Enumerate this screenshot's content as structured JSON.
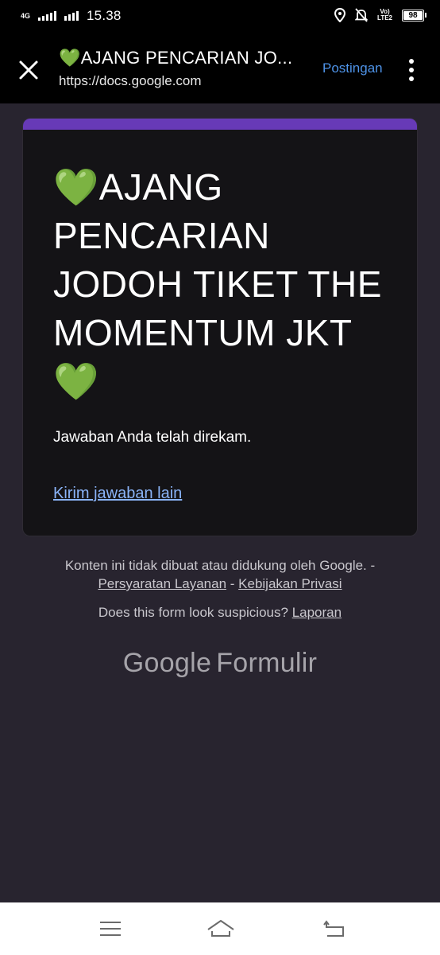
{
  "status_bar": {
    "network_type": "4G",
    "time": "15.38",
    "volte_label": "VoLTE2",
    "battery_level": "98",
    "icons": [
      "signal-icon",
      "location-icon",
      "mute-icon",
      "battery-icon"
    ]
  },
  "app_bar": {
    "title": "💚AJANG PENCARIAN JO...",
    "url": "https://docs.google.com",
    "action_label": "Postingan",
    "icons": [
      "close-icon",
      "more-vert-icon"
    ]
  },
  "form": {
    "accent_color": "#673ab7",
    "title": "💚AJANG PENCARIAN JODOH TIKET THE MOMENTUM JKT 💚",
    "confirmation_message": "Jawaban Anda telah direkam.",
    "resubmit_link": "Kirim jawaban lain"
  },
  "footer": {
    "disclaimer": "Konten ini tidak dibuat atau didukung oleh Google. -",
    "terms_link": "Persyaratan Layanan",
    "separator": " - ",
    "privacy_link": "Kebijakan Privasi",
    "suspicious_text": "Does this form look suspicious? ",
    "report_link": "Laporan",
    "brand_google": "Google",
    "brand_product": "Formulir"
  },
  "nav_bar": {
    "icons": [
      "menu-icon",
      "home-icon",
      "back-icon"
    ]
  },
  "colors": {
    "background": "#28242f",
    "card": "#141316",
    "link": "#8ab4f8",
    "action": "#4e93e8"
  }
}
